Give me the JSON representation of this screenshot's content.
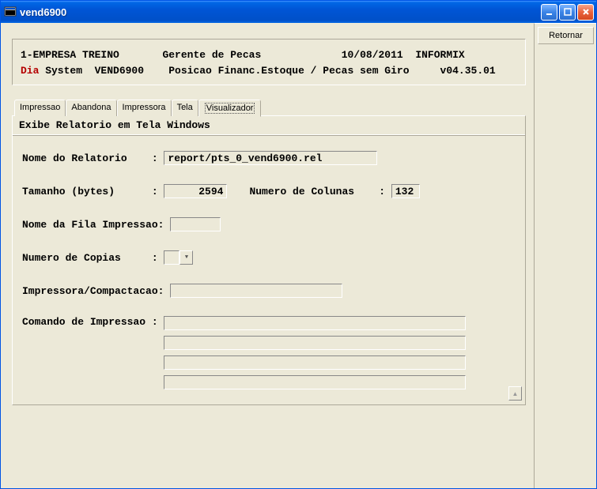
{
  "window": {
    "title": "vend6900"
  },
  "side": {
    "retornar": "Retornar"
  },
  "header": {
    "company": "1-EMPRESA TREINO",
    "role": "Gerente de Pecas",
    "date": "10/08/2011",
    "db": "INFORMIX",
    "dia": "Dia",
    "system": " System  VEND6900",
    "desc": "Posicao Financ.Estoque / Pecas sem Giro",
    "version": "v04.35.01"
  },
  "tabs": {
    "impressao": "Impressao",
    "abandona": "Abandona",
    "impressora": "Impressora",
    "tela": "Tela",
    "visualizador": "Visualizador"
  },
  "panel": {
    "caption": "Exibe Relatorio em Tela Windows"
  },
  "form": {
    "nome_relatorio_label": "Nome do Relatorio    : ",
    "nome_relatorio_value": "report/pts_0_vend6900.rel",
    "tamanho_label": "Tamanho (bytes)      : ",
    "tamanho_value": "2594",
    "colunas_label": "Numero de Colunas    : ",
    "colunas_value": "132",
    "fila_label": "Nome da Fila Impressao: ",
    "fila_value": "",
    "copias_label": "Numero de Copias     : ",
    "copias_value": "",
    "impressora_label": "Impressora/Compactacao: ",
    "impressora_value": "",
    "comando_label": "Comando de Impressao : ",
    "comando_l1": "",
    "comando_l2": "",
    "comando_l3": "",
    "comando_l4": ""
  }
}
